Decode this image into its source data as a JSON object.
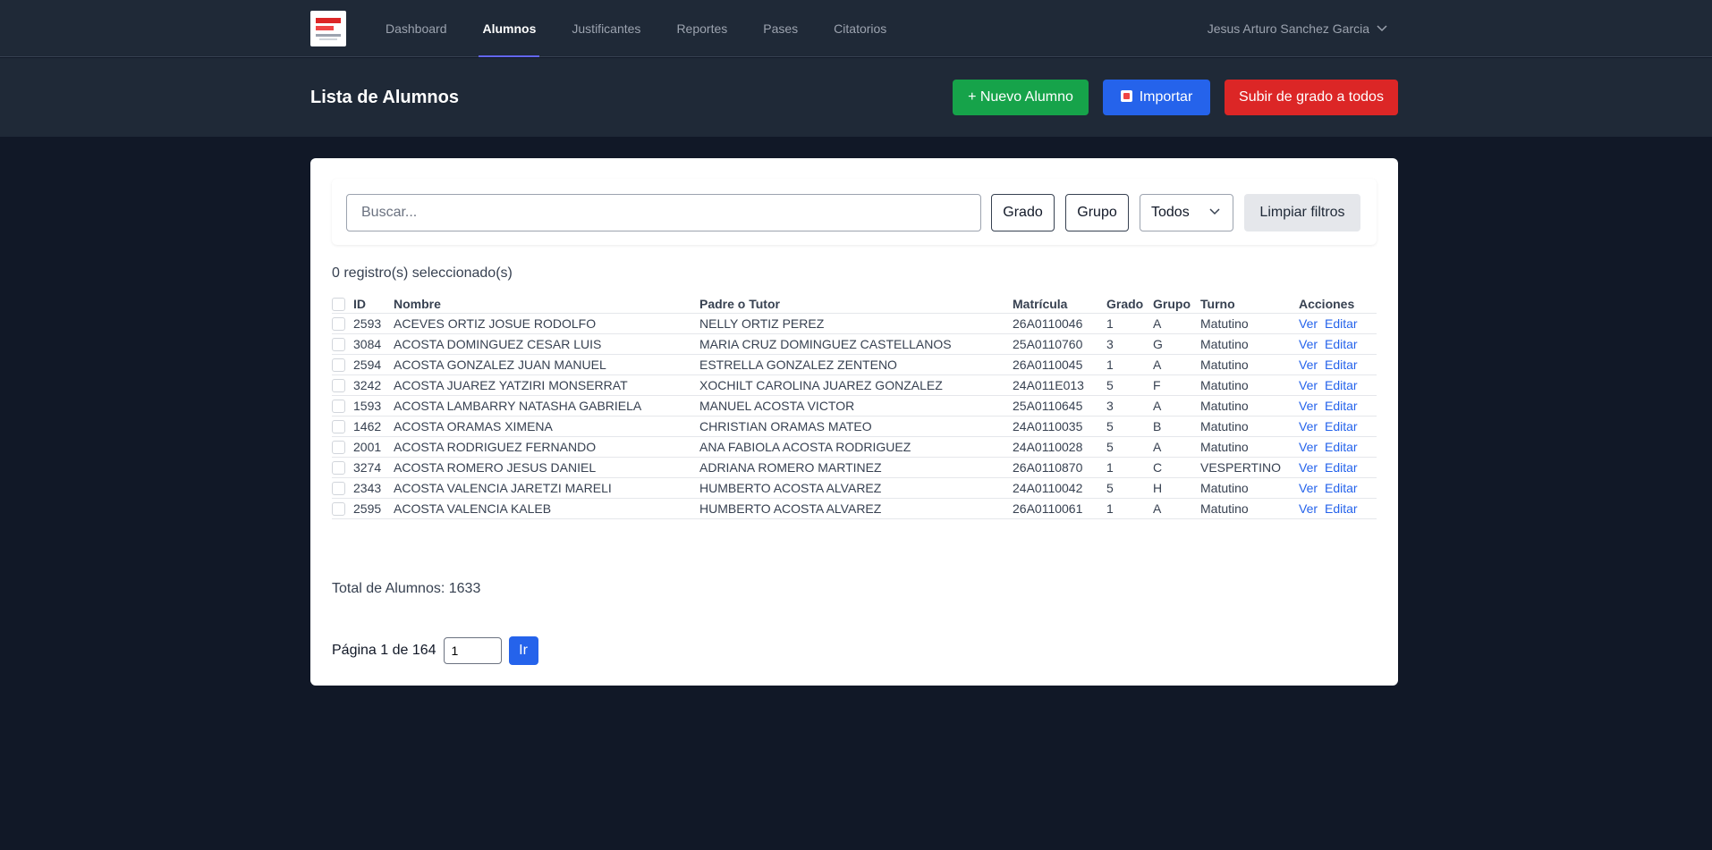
{
  "nav": {
    "items": [
      {
        "label": "Dashboard",
        "active": false
      },
      {
        "label": "Alumnos",
        "active": true
      },
      {
        "label": "Justificantes",
        "active": false
      },
      {
        "label": "Reportes",
        "active": false
      },
      {
        "label": "Pases",
        "active": false
      },
      {
        "label": "Citatorios",
        "active": false
      }
    ],
    "user": "Jesus Arturo Sanchez Garcia"
  },
  "header": {
    "title": "Lista de Alumnos",
    "new_button": "+ Nuevo Alumno",
    "import_button": "Importar",
    "promote_button": "Subir de grado a todos"
  },
  "filters": {
    "search_placeholder": "Buscar...",
    "grado": "Grado",
    "grupo": "Grupo",
    "turno_selected": "Todos",
    "clear": "Limpiar filtros"
  },
  "selected_text": "0 registro(s) seleccionado(s)",
  "table": {
    "headers": [
      "ID",
      "Nombre",
      "Padre o Tutor",
      "Matrícula",
      "Grado",
      "Grupo",
      "Turno",
      "Acciones"
    ],
    "action_view": "Ver",
    "action_edit": "Editar",
    "rows": [
      {
        "id": "2593",
        "nombre": "ACEVES ORTIZ JOSUE RODOLFO",
        "tutor": "NELLY ORTIZ PEREZ",
        "matricula": "26A0110046",
        "grado": "1",
        "grupo": "A",
        "turno": "Matutino"
      },
      {
        "id": "3084",
        "nombre": "ACOSTA DOMINGUEZ CESAR LUIS",
        "tutor": "MARIA CRUZ DOMINGUEZ CASTELLANOS",
        "matricula": "25A0110760",
        "grado": "3",
        "grupo": "G",
        "turno": "Matutino"
      },
      {
        "id": "2594",
        "nombre": "ACOSTA GONZALEZ JUAN MANUEL",
        "tutor": "ESTRELLA GONZALEZ ZENTENO",
        "matricula": "26A0110045",
        "grado": "1",
        "grupo": "A",
        "turno": "Matutino"
      },
      {
        "id": "3242",
        "nombre": "ACOSTA JUAREZ YATZIRI MONSERRAT",
        "tutor": "XOCHILT CAROLINA JUAREZ GONZALEZ",
        "matricula": "24A011E013",
        "grado": "5",
        "grupo": "F",
        "turno": "Matutino"
      },
      {
        "id": "1593",
        "nombre": "ACOSTA LAMBARRY NATASHA GABRIELA",
        "tutor": "MANUEL ACOSTA VICTOR",
        "matricula": "25A0110645",
        "grado": "3",
        "grupo": "A",
        "turno": "Matutino"
      },
      {
        "id": "1462",
        "nombre": "ACOSTA ORAMAS XIMENA",
        "tutor": "CHRISTIAN ORAMAS MATEO",
        "matricula": "24A0110035",
        "grado": "5",
        "grupo": "B",
        "turno": "Matutino"
      },
      {
        "id": "2001",
        "nombre": "ACOSTA RODRIGUEZ FERNANDO",
        "tutor": "ANA FABIOLA ACOSTA RODRIGUEZ",
        "matricula": "24A0110028",
        "grado": "5",
        "grupo": "A",
        "turno": "Matutino"
      },
      {
        "id": "3274",
        "nombre": "ACOSTA ROMERO JESUS DANIEL",
        "tutor": "ADRIANA ROMERO MARTINEZ",
        "matricula": "26A0110870",
        "grado": "1",
        "grupo": "C",
        "turno": "VESPERTINO"
      },
      {
        "id": "2343",
        "nombre": "ACOSTA VALENCIA JARETZI MARELI",
        "tutor": "HUMBERTO ACOSTA ALVAREZ",
        "matricula": "24A0110042",
        "grado": "5",
        "grupo": "H",
        "turno": "Matutino"
      },
      {
        "id": "2595",
        "nombre": "ACOSTA VALENCIA KALEB",
        "tutor": "HUMBERTO ACOSTA ALVAREZ",
        "matricula": "26A0110061",
        "grado": "1",
        "grupo": "A",
        "turno": "Matutino"
      }
    ]
  },
  "total_text": "Total de Alumnos: 1633",
  "pager": {
    "label": "Página 1 de 164",
    "input_value": "1",
    "go": "Ir"
  }
}
